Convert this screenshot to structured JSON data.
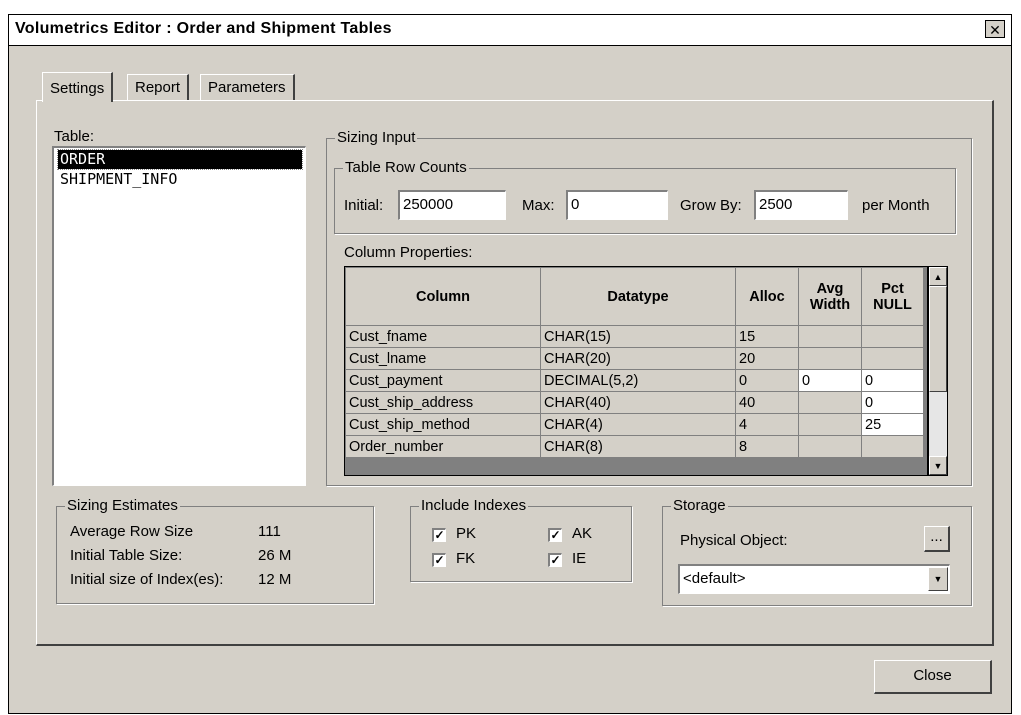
{
  "window": {
    "title": "Volumetrics Editor : Order and Shipment Tables",
    "close_glyph": "✕"
  },
  "tabs": [
    {
      "label": "Settings"
    },
    {
      "label": "Report"
    },
    {
      "label": "Parameters"
    }
  ],
  "table_list": {
    "label": "Table:",
    "items": [
      "ORDER",
      "SHIPMENT_INFO"
    ],
    "selected": "ORDER"
  },
  "sizing_input": {
    "legend": "Sizing Input",
    "row_counts": {
      "legend": "Table Row Counts",
      "initial_label": "Initial:",
      "initial_value": "250000",
      "max_label": "Max:",
      "max_value": "0",
      "grow_label": "Grow By:",
      "grow_value": "2500",
      "per_label": "per Month"
    },
    "column_properties_label": "Column Properties:",
    "headers": {
      "column": "Column",
      "datatype": "Datatype",
      "alloc": "Alloc",
      "avg_width": "Avg Width",
      "pct_null": "Pct NULL"
    },
    "rows": [
      {
        "column": "Cust_fname",
        "datatype": "CHAR(15)",
        "alloc": "15",
        "avg_width": "",
        "pct_null": ""
      },
      {
        "column": "Cust_lname",
        "datatype": "CHAR(20)",
        "alloc": "20",
        "avg_width": "",
        "pct_null": ""
      },
      {
        "column": "Cust_payment",
        "datatype": "DECIMAL(5,2)",
        "alloc": "0",
        "avg_width": "0",
        "pct_null": "0"
      },
      {
        "column": "Cust_ship_address",
        "datatype": "CHAR(40)",
        "alloc": "40",
        "avg_width": "",
        "pct_null": "0"
      },
      {
        "column": "Cust_ship_method",
        "datatype": "CHAR(4)",
        "alloc": "4",
        "avg_width": "",
        "pct_null": "25"
      },
      {
        "column": "Order_number",
        "datatype": "CHAR(8)",
        "alloc": "8",
        "avg_width": "",
        "pct_null": ""
      }
    ]
  },
  "sizing_estimates": {
    "legend": "Sizing Estimates",
    "avg_row_label": "Average Row Size",
    "avg_row_value": "111",
    "init_table_label": "Initial Table Size:",
    "init_table_value": "26 M",
    "init_index_label": "Initial size of Index(es):",
    "init_index_value": "12 M"
  },
  "include_indexes": {
    "legend": "Include Indexes",
    "pk": "PK",
    "ak": "AK",
    "fk": "FK",
    "ie": "IE",
    "check_glyph": "✓"
  },
  "storage": {
    "legend": "Storage",
    "physical_label": "Physical Object:",
    "browse_label": "...",
    "select_value": "<default>"
  },
  "close_button": "Close"
}
